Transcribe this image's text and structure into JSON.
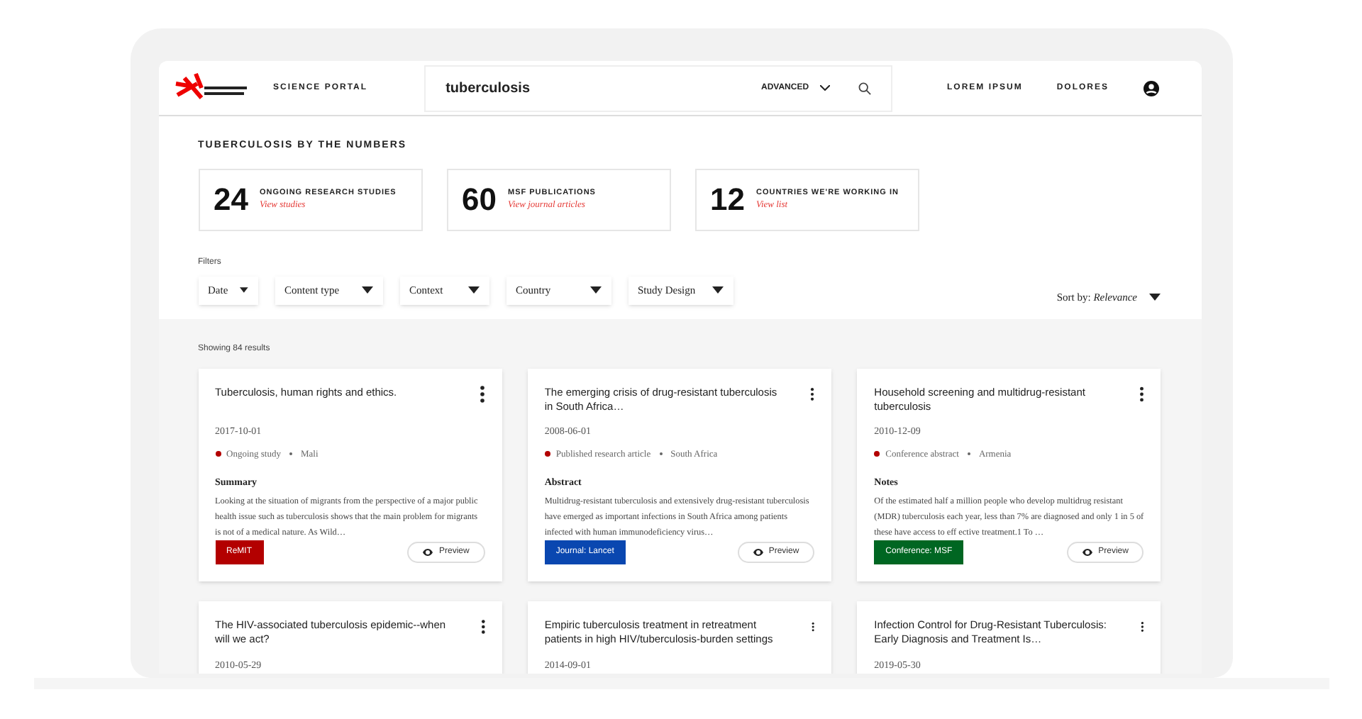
{
  "header": {
    "brand": "SCIENCE PORTAL",
    "search": {
      "value": "tuberculosis"
    },
    "advanced": "ADVANCED",
    "nav": [
      "LOREM IPSUM",
      "DOLORES"
    ]
  },
  "numbers": {
    "title": "TUBERCULOSIS BY THE NUMBERS",
    "stats": [
      {
        "value": "24",
        "label": "ONGOING RESEARCH STUDIES",
        "link": "View studies"
      },
      {
        "value": "60",
        "label": "MSF PUBLICATIONS",
        "link": "View journal articles"
      },
      {
        "value": "12",
        "label": "COUNTRIES WE'RE WORKING IN",
        "link": "View list"
      }
    ]
  },
  "filters": {
    "label": "Filters",
    "dropdowns": [
      "Date",
      "Content type",
      "Context",
      "Country",
      "Study Design"
    ],
    "sort_label": "Sort by:",
    "sort_value": "Relevance"
  },
  "results": {
    "count": "Showing 84 results",
    "cards": [
      {
        "title": "Tuberculosis, human rights and ethics.",
        "date": "2017-10-01",
        "type": "Ongoing study",
        "country": "Mali",
        "section": "Summary",
        "text": "Looking at the situation of migrants from the perspective of a major public health issue such as tuberculosis shows that the main problem for migrants is not of a medical nature. As Wild…",
        "tag": "ReMIT",
        "color": "#b30000",
        "preview": "Preview"
      },
      {
        "title": "The emerging crisis of drug-resistant tuberculosis in South Africa…",
        "date": "2008-06-01",
        "type": "Published research article",
        "country": "South Africa",
        "section": "Abstract",
        "text": "Multidrug-resistant tuberculosis and extensively drug-resistant tuberculosis have emerged as important infections in South Africa among patients infected with human immunodeficiency virus…",
        "tag": "Journal: Lancet",
        "color": "#0a47b0",
        "preview": "Preview"
      },
      {
        "title": "Household screening and multidrug-resistant tuberculosis",
        "date": "2010-12-09",
        "type": "Conference abstract",
        "country": "Armenia",
        "section": "Notes",
        "text": "Of the estimated half a million people who develop multidrug resistant (MDR) tuberculosis each year, less than 7% are diagnosed and only 1 in 5 of these have access to eff ective treatment.1 To …",
        "tag": "Conference: MSF",
        "color": "#006622",
        "preview": "Preview"
      },
      {
        "title": "The HIV-associated tuberculosis epidemic--when will we act?",
        "date": "2010-05-29"
      },
      {
        "title": "Empiric tuberculosis treatment in retreatment patients in high HIV/tuberculosis-burden settings",
        "date": "2014-09-01"
      },
      {
        "title": "Infection Control for Drug-Resistant Tuberculosis: Early Diagnosis and Treatment Is…",
        "date": "2019-05-30"
      }
    ]
  }
}
